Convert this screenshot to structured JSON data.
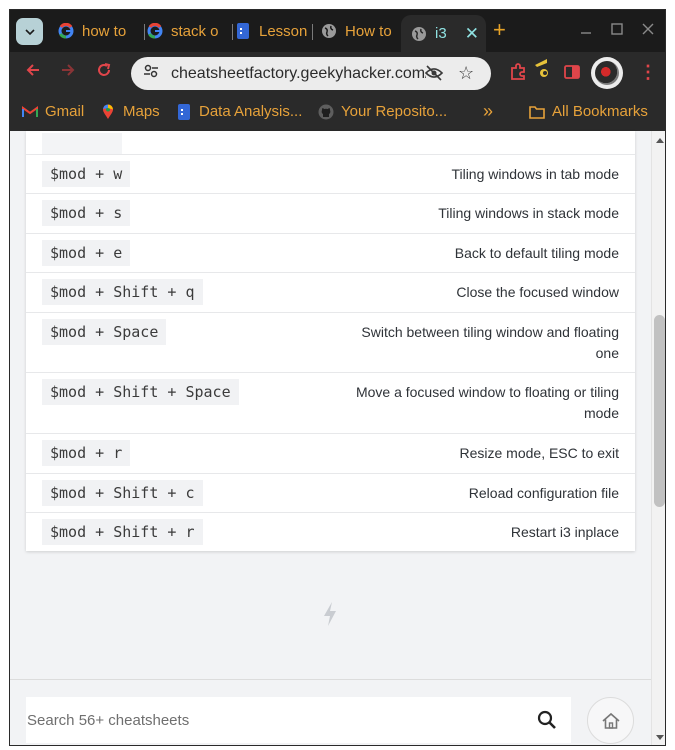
{
  "browser": {
    "tabs": [
      {
        "title": "how to",
        "favicon": "google-icon"
      },
      {
        "title": "stack o",
        "favicon": "google-icon"
      },
      {
        "title": "Lesson",
        "favicon": "document-icon"
      },
      {
        "title": "How to",
        "favicon": "globe-icon"
      },
      {
        "title": "i3",
        "favicon": "globe-icon",
        "active": true
      }
    ],
    "new_tab_label": "+",
    "url": "cheatsheetfactory.geekyhacker.com/l...",
    "bookmarks": [
      {
        "label": "Gmail",
        "icon": "gmail-icon"
      },
      {
        "label": "Maps",
        "icon": "maps-icon"
      },
      {
        "label": "Data Analysis...",
        "icon": "document-icon"
      },
      {
        "label": "Your Reposito...",
        "icon": "github-icon"
      }
    ],
    "bookmarks_overflow": "»",
    "all_bookmarks": "All Bookmarks",
    "colors": {
      "tab_text": "#e7a23a",
      "active_tab_text": "#8fe2e2",
      "nav_red": "#e0454a"
    }
  },
  "shortcuts": [
    {
      "keys": "$mod + w",
      "description": "Tiling windows in tab mode"
    },
    {
      "keys": "$mod + s",
      "description": "Tiling windows in stack mode"
    },
    {
      "keys": "$mod + e",
      "description": "Back to default tiling mode"
    },
    {
      "keys": "$mod + Shift + q",
      "description": "Close the focused window"
    },
    {
      "keys": "$mod + Space",
      "description_lines": [
        "Switch between tiling window and floating",
        "one"
      ]
    },
    {
      "keys": "$mod + Shift + Space",
      "description_lines": [
        "Move a focused window to floating or tiling",
        "mode"
      ]
    },
    {
      "keys": "$mod + r",
      "description": "Resize mode, ESC to exit"
    },
    {
      "keys": "$mod + Shift + c",
      "description": "Reload configuration file"
    },
    {
      "keys": "$mod + Shift + r",
      "description": "Restart i3 inplace"
    }
  ],
  "footer": {
    "search_placeholder": "Search 56+ cheatsheets",
    "search_icon": "search-icon",
    "home_icon": "home-icon"
  }
}
